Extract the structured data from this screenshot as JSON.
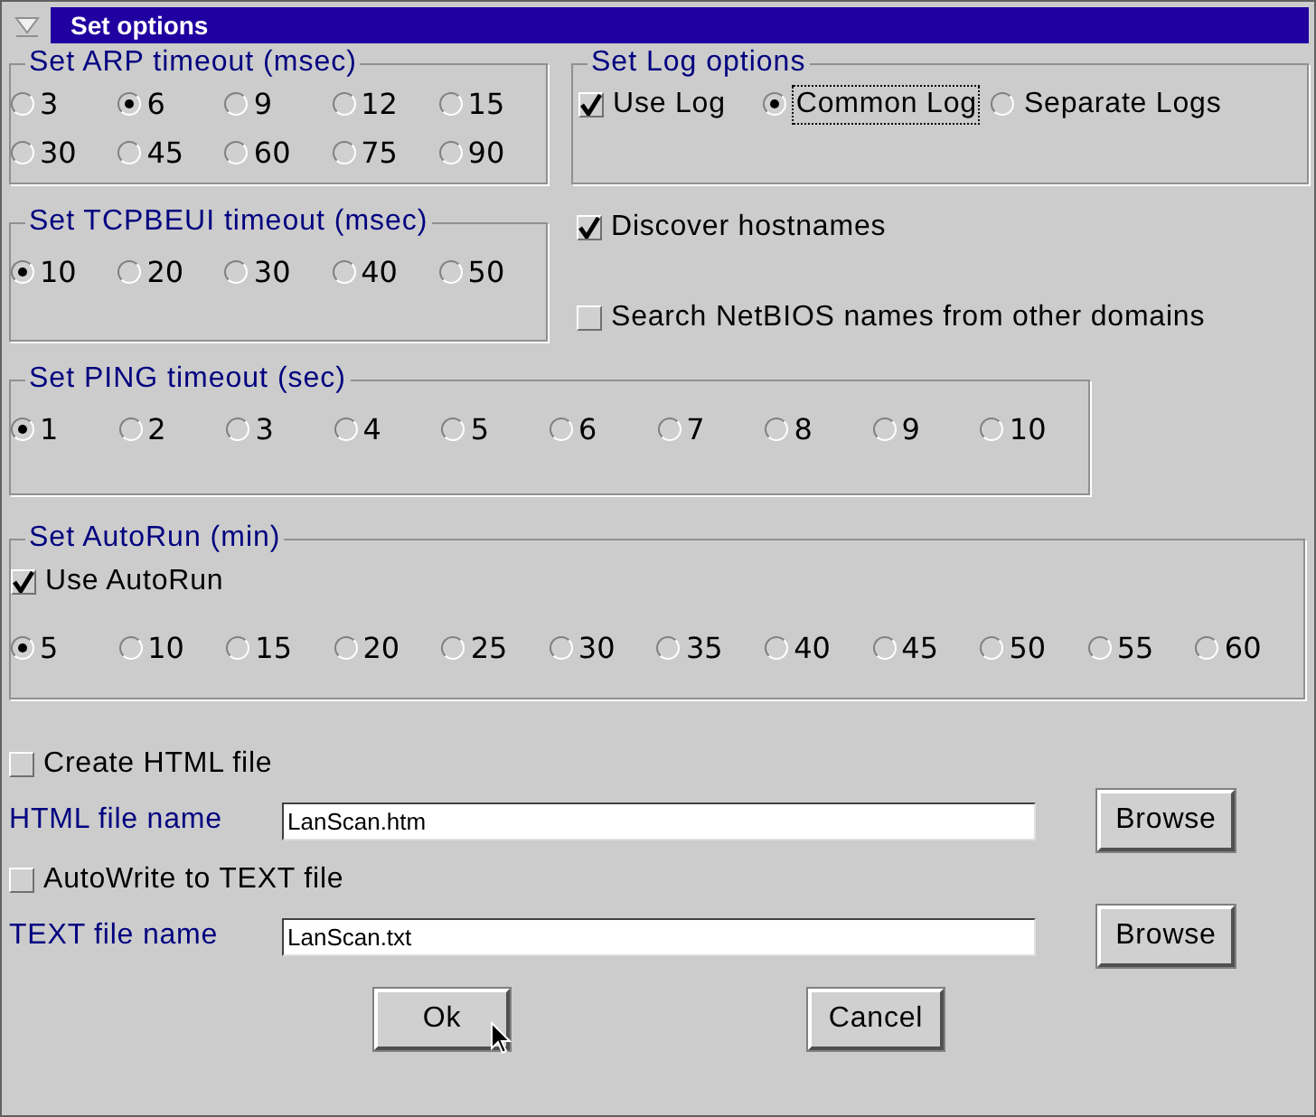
{
  "window": {
    "title": "Set options"
  },
  "arp_timeout": {
    "title": "Set ARP timeout (msec)",
    "options": [
      {
        "label": "3",
        "selected": false
      },
      {
        "label": "6",
        "selected": true
      },
      {
        "label": "9",
        "selected": false
      },
      {
        "label": "12",
        "selected": false
      },
      {
        "label": "15",
        "selected": false
      },
      {
        "label": "30",
        "selected": false
      },
      {
        "label": "45",
        "selected": false
      },
      {
        "label": "60",
        "selected": false
      },
      {
        "label": "75",
        "selected": false
      },
      {
        "label": "90",
        "selected": false
      }
    ]
  },
  "log_options": {
    "title": "Set Log options",
    "use_log": {
      "label": "Use Log",
      "checked": true
    },
    "modes": [
      {
        "label": "Common Log",
        "selected": true,
        "focused": true
      },
      {
        "label": "Separate Logs",
        "selected": false,
        "focused": false
      }
    ]
  },
  "tcpbeui_timeout": {
    "title": "Set TCPBEUI timeout (msec)",
    "options": [
      {
        "label": "10",
        "selected": true
      },
      {
        "label": "20",
        "selected": false
      },
      {
        "label": "30",
        "selected": false
      },
      {
        "label": "40",
        "selected": false
      },
      {
        "label": "50",
        "selected": false
      }
    ]
  },
  "discover_hostnames": {
    "label": "Discover hostnames",
    "checked": true
  },
  "search_netbios": {
    "label": "Search NetBIOS names from other domains",
    "checked": false
  },
  "ping_timeout": {
    "title": "Set PING timeout (sec)",
    "options": [
      {
        "label": "1",
        "selected": true
      },
      {
        "label": "2",
        "selected": false
      },
      {
        "label": "3",
        "selected": false
      },
      {
        "label": "4",
        "selected": false
      },
      {
        "label": "5",
        "selected": false
      },
      {
        "label": "6",
        "selected": false
      },
      {
        "label": "7",
        "selected": false
      },
      {
        "label": "8",
        "selected": false
      },
      {
        "label": "9",
        "selected": false
      },
      {
        "label": "10",
        "selected": false
      }
    ]
  },
  "autorun": {
    "title": "Set AutoRun (min)",
    "use_autorun": {
      "label": "Use AutoRun",
      "checked": true
    },
    "options": [
      {
        "label": "5",
        "selected": true
      },
      {
        "label": "10",
        "selected": false
      },
      {
        "label": "15",
        "selected": false
      },
      {
        "label": "20",
        "selected": false
      },
      {
        "label": "25",
        "selected": false
      },
      {
        "label": "30",
        "selected": false
      },
      {
        "label": "35",
        "selected": false
      },
      {
        "label": "40",
        "selected": false
      },
      {
        "label": "45",
        "selected": false
      },
      {
        "label": "50",
        "selected": false
      },
      {
        "label": "55",
        "selected": false
      },
      {
        "label": "60",
        "selected": false
      }
    ]
  },
  "create_html": {
    "label": "Create HTML file",
    "checked": false
  },
  "html_file": {
    "label": "HTML file name",
    "value": "LanScan.htm",
    "browse": "Browse"
  },
  "autowrite_text": {
    "label": "AutoWrite to TEXT file",
    "checked": false
  },
  "text_file": {
    "label": "TEXT file name",
    "value": "LanScan.txt",
    "browse": "Browse"
  },
  "buttons": [
    {
      "label": "Ok"
    },
    {
      "label": "Cancel"
    }
  ]
}
